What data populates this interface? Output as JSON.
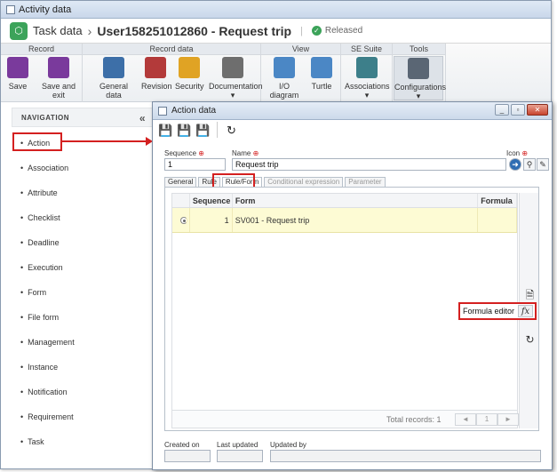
{
  "window": {
    "title": "Activity data"
  },
  "header": {
    "breadcrumb": "Task data",
    "record_name": "User158251012860 - Request trip",
    "status": "Released"
  },
  "ribbon": {
    "groups": [
      "Record",
      "Record data",
      "View",
      "SE Suite",
      "Tools"
    ],
    "buttons": {
      "save": "Save",
      "save_exit": "Save and exit",
      "general_data": "General data",
      "revision": "Revision",
      "security": "Security",
      "documentation": "Documentation",
      "io_diagram": "I/O diagram",
      "turtle": "Turtle",
      "associations": "Associations",
      "configurations": "Configurations"
    }
  },
  "navigation": {
    "title": "NAVIGATION",
    "collapse": "«",
    "items": [
      "Action",
      "Association",
      "Attribute",
      "Checklist",
      "Deadline",
      "Execution",
      "Form",
      "File form",
      "Management",
      "Instance",
      "Notification",
      "Requirement",
      "Task"
    ]
  },
  "dialog": {
    "title": "Action data",
    "fields": {
      "sequence_label": "Sequence",
      "sequence_value": "1",
      "name_label": "Name",
      "name_value": "Request trip",
      "icon_label": "Icon"
    },
    "tabs": [
      "General",
      "Rule",
      "Rule/Form",
      "Conditional expression",
      "Parameter"
    ],
    "grid": {
      "columns": [
        "Sequence",
        "Form",
        "Formula"
      ],
      "rows": [
        {
          "sequence": "1",
          "form": "SV001 - Request trip",
          "formula": ""
        }
      ],
      "total_records": "Total records: 1",
      "page": "1",
      "prev": "◄",
      "next": "►"
    },
    "formula_editor": {
      "label": "Formula editor",
      "icon": "fx"
    },
    "footer": {
      "created_on": "Created on",
      "last_updated": "Last updated",
      "updated_by": "Updated by"
    }
  },
  "colors": {
    "highlight": "#d42020",
    "selected_row": "#fdfbd4",
    "brand": "#3ca35a"
  }
}
